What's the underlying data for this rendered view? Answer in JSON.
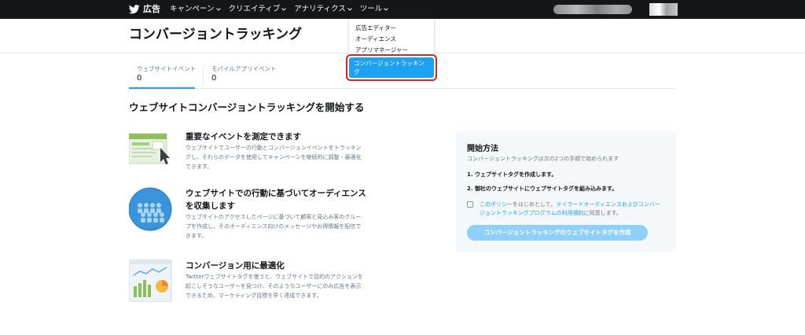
{
  "nav": {
    "brand": "広告",
    "menus": [
      {
        "label": "キャンペーン"
      },
      {
        "label": "クリエイティブ"
      },
      {
        "label": "アナリティクス"
      },
      {
        "label": "ツール"
      }
    ]
  },
  "header": {
    "title": "コンバージョントラッキング"
  },
  "dropdown": {
    "items": [
      "広告エディター",
      "オーディエンス",
      "アプリマネージャー"
    ],
    "active": "コンバージョントラッキング"
  },
  "tabs": [
    {
      "label": "ウェブサイトイベント",
      "count": "0"
    },
    {
      "label": "モバイルアプリイベント",
      "count": "0"
    }
  ],
  "section_title": "ウェブサイトコンバージョントラッキングを開始する",
  "features": [
    {
      "title": "重要なイベントを測定できます",
      "desc": "ウェブサイトでユーザーの行動とコンバージョンイベントをトラッキングし、それらのデータを使用してキャンペーンを継続的に調整・最適化できます。"
    },
    {
      "title": "ウェブサイトでの行動に基づいてオーディエンスを収集します",
      "desc": "ウェブサイトのアクセスしたページに基づいて顧客と見込み客のグループを作成し、そのオーディエンス向けのメッセージやお得情報を配信できます。"
    },
    {
      "title": "コンバージョン用に最適化",
      "desc": "Twitterウェブサイトタグを使うと、ウェブサイトで目的のアクションを起こしそうなユーザーを見つけ、そのようなユーザーにのみ広告を表示できるため、マーケティング目標を早く達成できます。"
    }
  ],
  "howto": {
    "title": "開始方法",
    "subtitle": "コンバージョントラッキングは次の2つの手順で始められます",
    "step1": "1. ウェブサイトタグを作成します。",
    "step2": "2. 御社のウェブサイトにウェブサイトタグを組み込みます。",
    "agree_link1": "このポリシー",
    "agree_mid": "をはじめとして、",
    "agree_link2": "テイラードオーディエンスおよびコンバージョントラッキングプログラムの利用規約",
    "agree_end": "に同意します。",
    "cta": "コンバージョントラッキングのウェブサイトタグを作成"
  },
  "colors": {
    "nav_bg": "#14171a",
    "accent": "#1da1f2",
    "highlight": "#d7232f",
    "panel_bg": "#f5f8fa"
  }
}
